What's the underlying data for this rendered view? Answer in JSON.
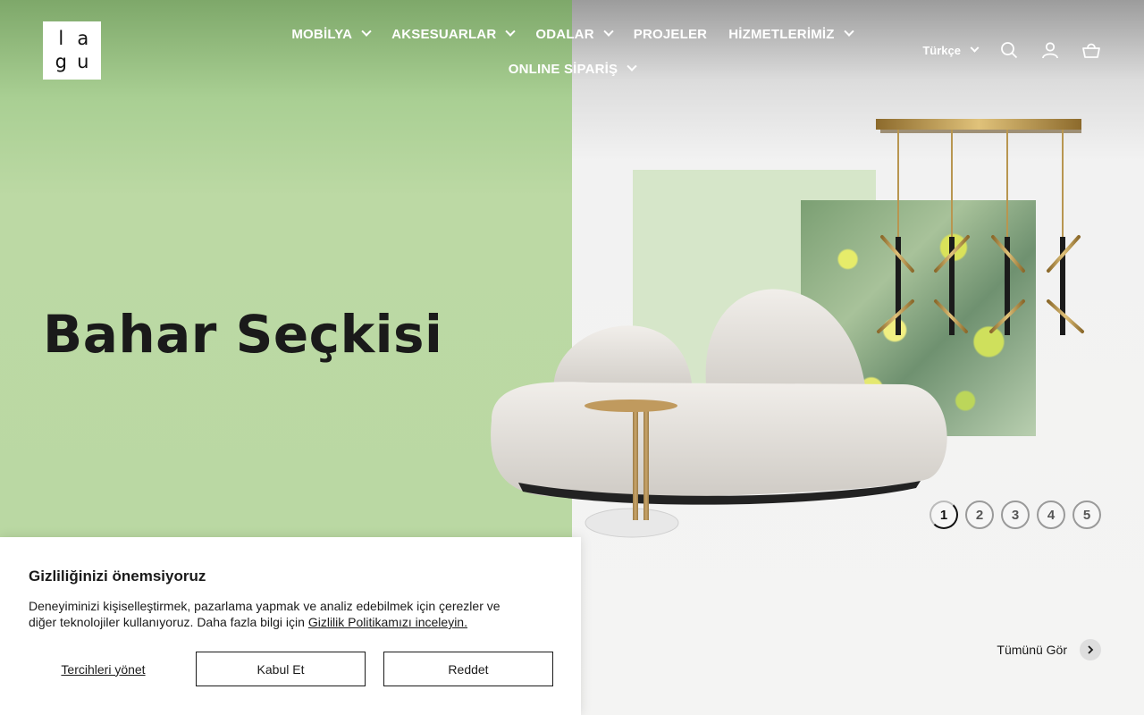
{
  "brand": {
    "logo_letters": [
      "l",
      "a",
      "g",
      "u"
    ]
  },
  "nav": {
    "row1": [
      {
        "label": "MOBİLYA",
        "has_dropdown": true
      },
      {
        "label": "AKSESUARLAR",
        "has_dropdown": true
      },
      {
        "label": "ODALAR",
        "has_dropdown": true
      },
      {
        "label": "PROJELER",
        "has_dropdown": false
      },
      {
        "label": "HİZMETLERİMİZ",
        "has_dropdown": true
      }
    ],
    "row2": [
      {
        "label": "ONLINE SİPARİŞ",
        "has_dropdown": true
      }
    ]
  },
  "header": {
    "language": "Türkçe",
    "icons": [
      "search-icon",
      "account-icon",
      "cart-icon"
    ]
  },
  "hero": {
    "title": "Bahar Seçkisi",
    "slides": [
      "1",
      "2",
      "3",
      "4",
      "5"
    ],
    "active_slide": 1,
    "see_all": "Tümünü Gör"
  },
  "cookie": {
    "title": "Gizliliğinizi önemsiyoruz",
    "text": "Deneyiminizi kişiselleştirmek, pazarlama yapmak ve analiz edebilmek için çerezler ve diğer teknolojiler kullanıyoruz. Daha fazla bilgi için",
    "link": "Gizlilik Politikamızı inceleyin.",
    "manage": "Tercihleri yönet",
    "accept": "Kabul Et",
    "reject": "Reddet"
  },
  "colors": {
    "hero_left": "#bcd9a4",
    "hero_right": "#f4f4f3",
    "text": "#1a1a1a"
  }
}
